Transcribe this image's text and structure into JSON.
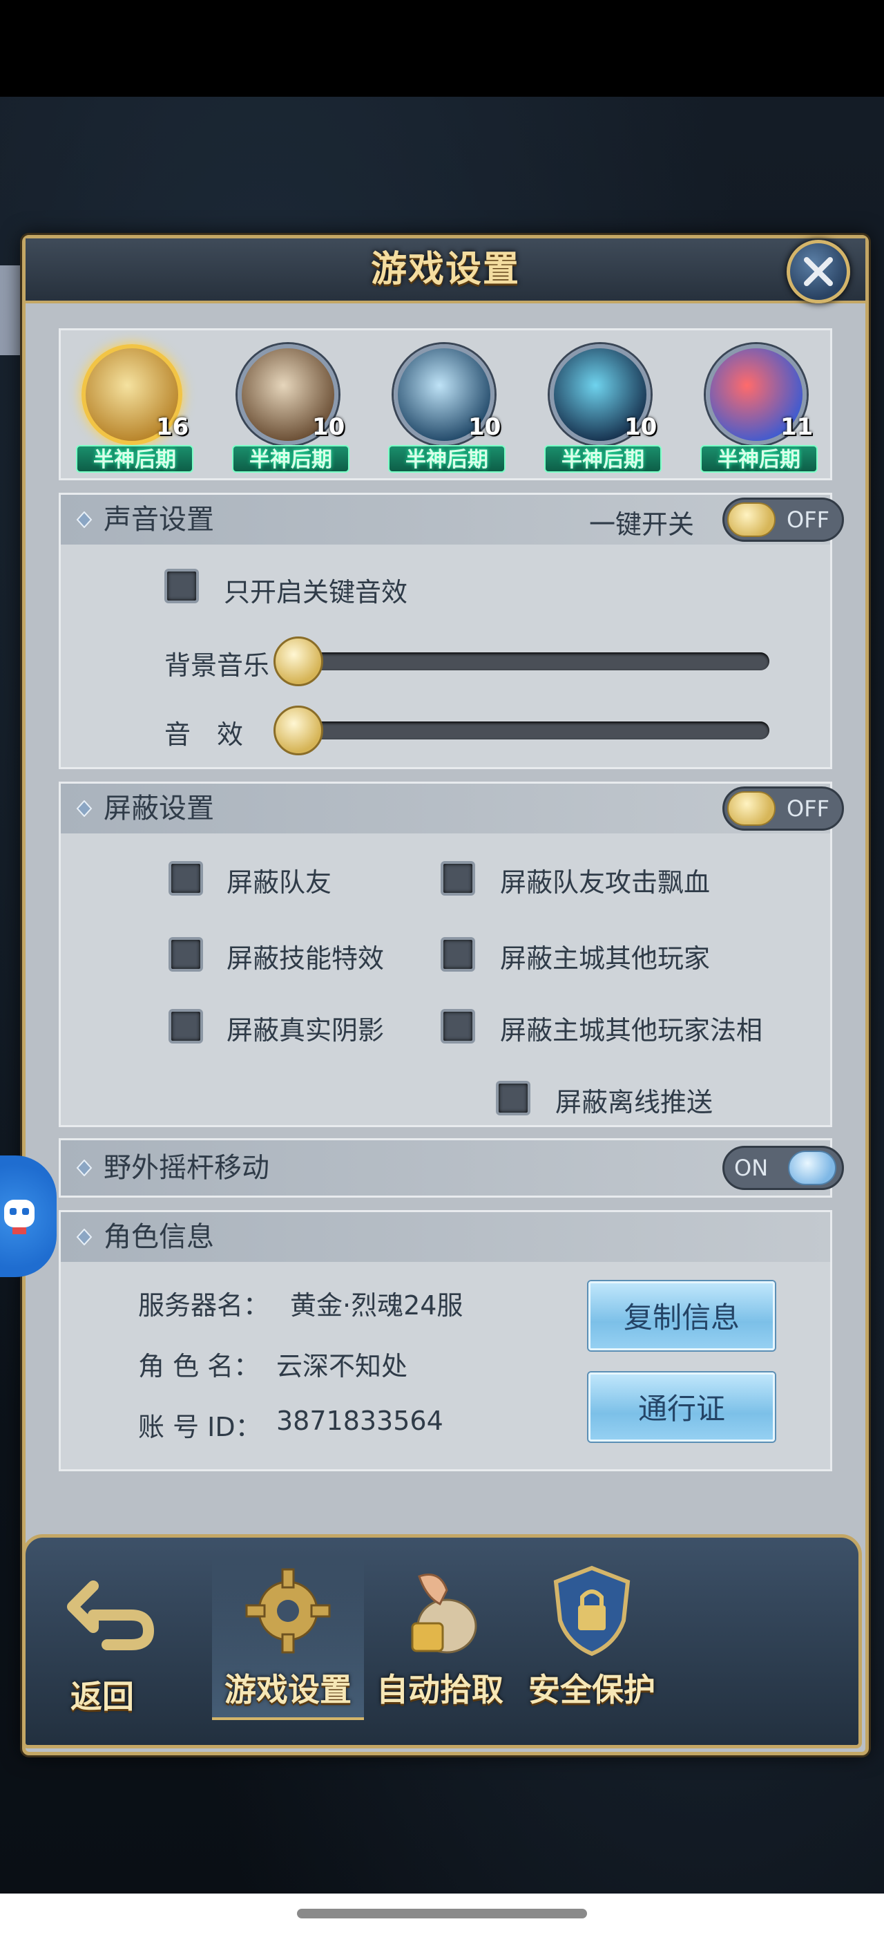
{
  "dialog": {
    "title": "游戏设置"
  },
  "heroes": [
    {
      "level": "16",
      "rank": "半神后期",
      "colors": [
        "#e8c35b",
        "#8fb3d8"
      ]
    },
    {
      "level": "10",
      "rank": "半神后期",
      "colors": [
        "#8a6a4a",
        "#d6c8b0"
      ]
    },
    {
      "level": "10",
      "rank": "半神后期",
      "colors": [
        "#2c4f6e",
        "#a9d4f2"
      ]
    },
    {
      "level": "10",
      "rank": "半神后期",
      "colors": [
        "#1e3b5c",
        "#4fb7d6"
      ]
    },
    {
      "level": "11",
      "rank": "半神后期",
      "colors": [
        "#c43c3c",
        "#4a6bd8"
      ]
    }
  ],
  "sound": {
    "title": "声音设置",
    "master_label": "一键开关",
    "master_state": "OFF",
    "key_sfx_label": "只开启关键音效",
    "bgm_label": "背景音乐",
    "bgm_level": 0,
    "sfx_label": "音　效",
    "sfx_level": 0
  },
  "block": {
    "title": "屏蔽设置",
    "state": "OFF",
    "options": {
      "teammates": "屏蔽队友",
      "teammate_damage": "屏蔽队友攻击飘血",
      "skill_effects": "屏蔽技能特效",
      "city_players": "屏蔽主城其他玩家",
      "real_shadows": "屏蔽真实阴影",
      "city_player_forms": "屏蔽主城其他玩家法相",
      "offline_push": "屏蔽离线推送"
    }
  },
  "joystick": {
    "title": "野外摇杆移动",
    "state": "ON"
  },
  "role": {
    "title": "角色信息",
    "server_label": "服务器名：",
    "server_value": "黄金·烈魂24服",
    "name_label": "角 色 名：",
    "name_value": "云深不知处",
    "id_label": "账 号 ID：",
    "id_value": "3871833564",
    "copy_button": "复制信息",
    "pass_button": "通行证"
  },
  "bottom_nav": {
    "back": "返回",
    "game_settings": "游戏设置",
    "auto_pickup": "自动拾取",
    "security": "安全保护"
  }
}
